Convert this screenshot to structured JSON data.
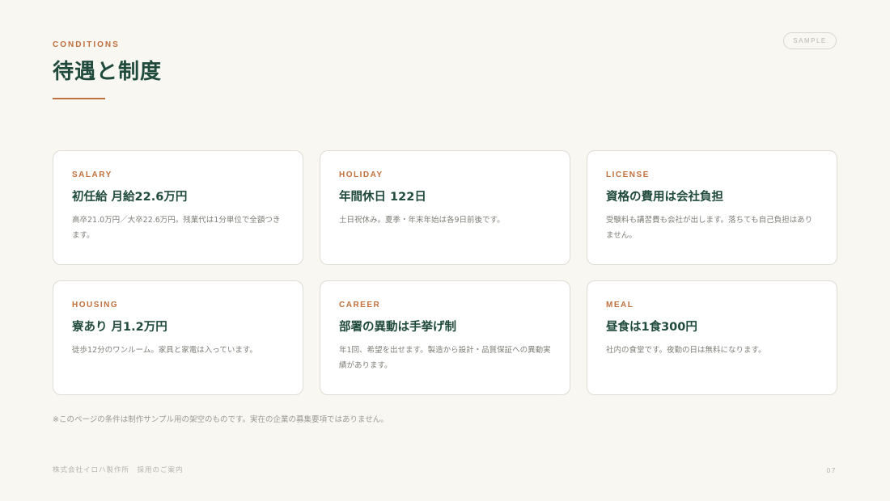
{
  "header": {
    "eyebrow": "CONDITIONS",
    "title": "待遇と制度",
    "badge": "SAMPLE"
  },
  "cards": [
    {
      "label": "SALARY",
      "title": "初任給 月給22.6万円",
      "description": "高卒21.0万円／大卒22.6万円。残業代は1分単位で全額つきます。"
    },
    {
      "label": "HOLIDAY",
      "title": "年間休日 122日",
      "description": "土日祝休み。夏季・年末年始は各9日前後です。"
    },
    {
      "label": "LICENSE",
      "title": "資格の費用は会社負担",
      "description": "受験料も講習費も会社が出します。落ちても自己負担はありません。"
    },
    {
      "label": "HOUSING",
      "title": "寮あり 月1.2万円",
      "description": "徒歩12分のワンルーム。家具と家電は入っています。"
    },
    {
      "label": "CAREER",
      "title": "部署の異動は手挙げ制",
      "description": "年1回、希望を出せます。製造から設計・品質保証への異動実績があります。"
    },
    {
      "label": "MEAL",
      "title": "昼食は1食300円",
      "description": "社内の食堂です。夜勤の日は無料になります。"
    }
  ],
  "footnote": "※このページの条件は制作サンプル用の架空のものです。実在の企業の募集要項ではありません。",
  "footer": {
    "company": "株式会社イロハ製作所　採用のご案内",
    "page_number": "07"
  },
  "colors": {
    "background": "#f8f7f2",
    "accent": "#c0703d",
    "heading": "#1f4a3c",
    "body_text": "#7d7d77",
    "card_border": "#dedcd3"
  }
}
